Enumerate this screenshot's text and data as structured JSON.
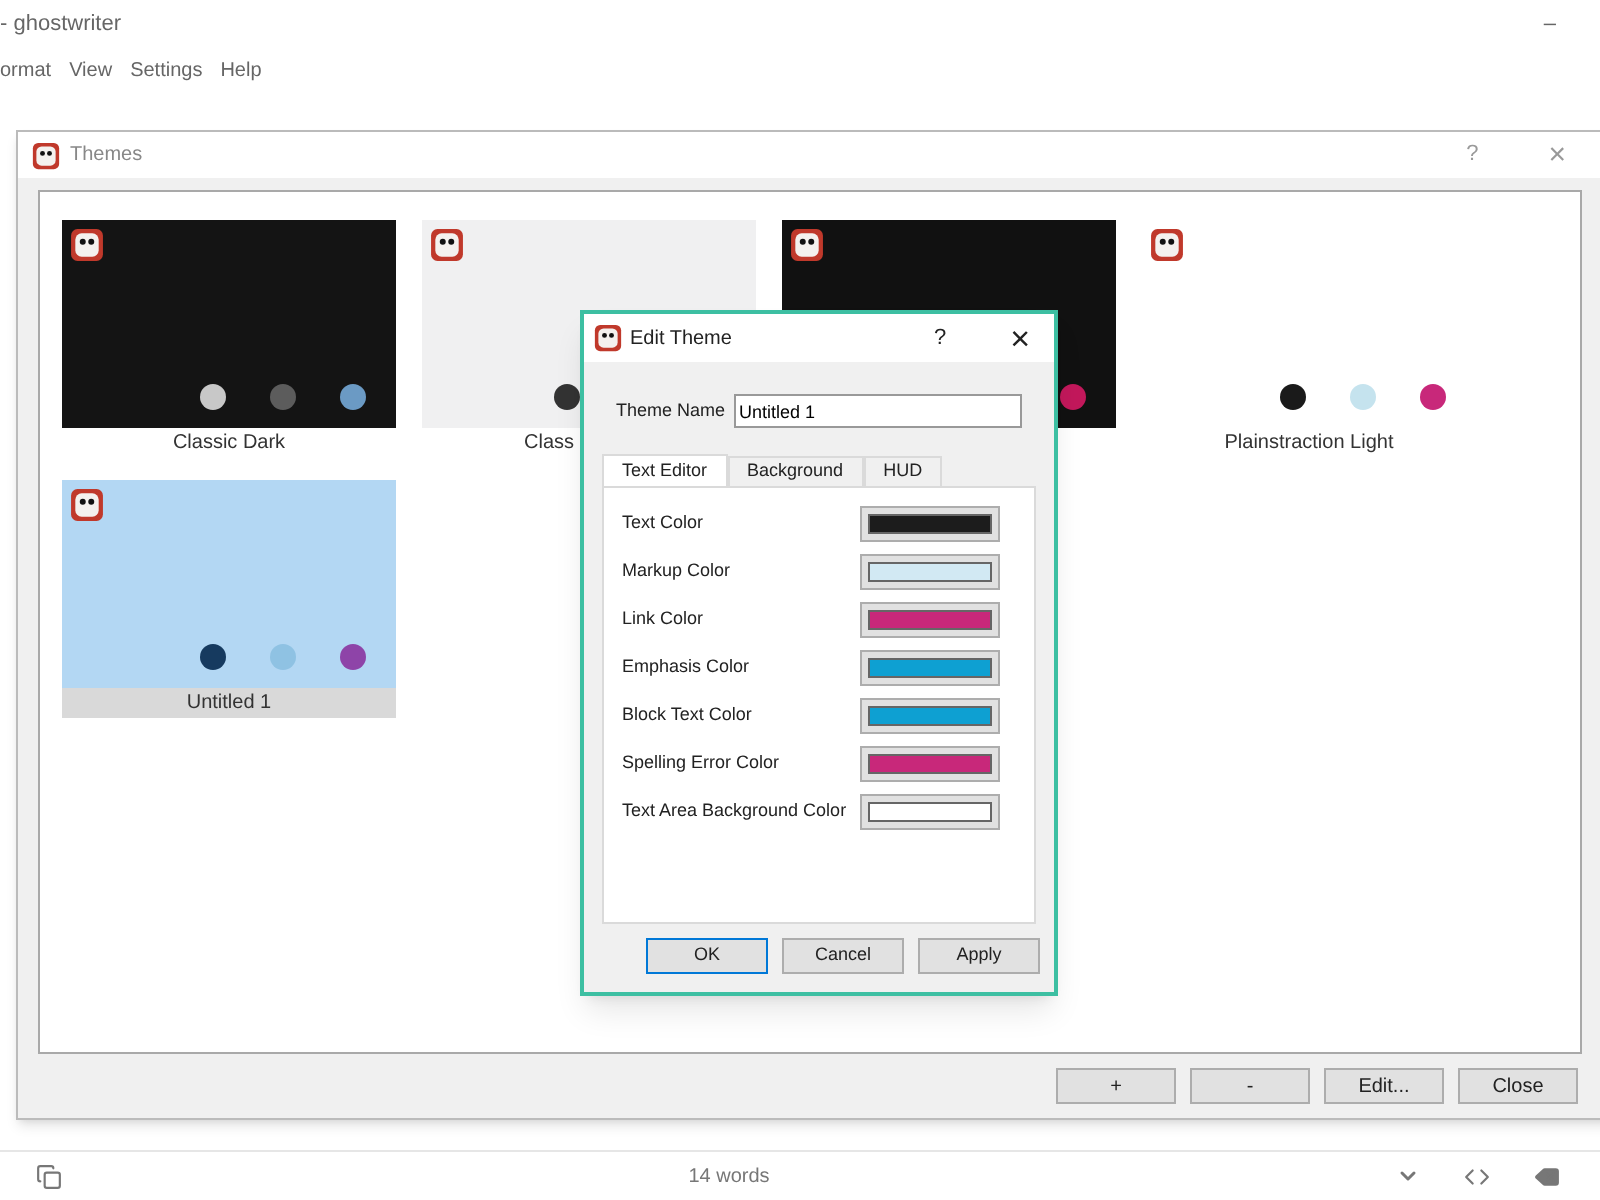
{
  "window": {
    "title": "- ghostwriter",
    "minimize": "–"
  },
  "menu": [
    "ormat",
    "View",
    "Settings",
    "Help"
  ],
  "themes_dialog": {
    "title": "Themes",
    "help": "?",
    "close": "×",
    "cards": [
      {
        "name": "Classic Dark",
        "color": "#141414",
        "selected": false,
        "dots": [
          {
            "color": "#c8c8c8"
          },
          {
            "color": "#5c5c5c"
          },
          {
            "color": "#6b9ac4"
          }
        ]
      },
      {
        "name": "Class",
        "color": "#f0f0f1",
        "selected": false,
        "dots": [
          {
            "color": "#333333"
          }
        ]
      },
      {
        "color": "#111111",
        "selected": false,
        "dots": [
          {
            "color": "#c2185b"
          }
        ]
      },
      {
        "name": "Plainstraction Light",
        "color": "#ffffff",
        "selected": false,
        "dots": [
          {
            "color": "#1a1a1a"
          },
          {
            "color": "#c5e3ee"
          },
          {
            "color": "#c8287a"
          }
        ]
      },
      {
        "name": "Untitled 1",
        "color": "#b3d7f3",
        "selected": true,
        "dots": [
          {
            "color": "#163a5f"
          },
          {
            "color": "#8fc2e3"
          },
          {
            "color": "#8e44a8"
          }
        ]
      }
    ],
    "buttons": [
      "+",
      "-",
      "Edit...",
      "Close"
    ]
  },
  "edit_dialog": {
    "title": "Edit Theme",
    "help": "?",
    "close": "×",
    "name_label": "Theme Name",
    "name_value": "Untitled 1",
    "tabs": [
      {
        "label": "Text Editor",
        "selected": true
      },
      {
        "label": "Background",
        "selected": false
      },
      {
        "label": "HUD",
        "selected": false
      }
    ],
    "colors": [
      {
        "label": "Text Color",
        "color": "#1c1c1c"
      },
      {
        "label": "Markup Color",
        "color": "#d2e9f3"
      },
      {
        "label": "Link Color",
        "color": "#c8287a"
      },
      {
        "label": "Emphasis Color",
        "color": "#0ea0d2"
      },
      {
        "label": "Block Text Color",
        "color": "#0ea0d2"
      },
      {
        "label": "Spelling Error Color",
        "color": "#c8287a"
      },
      {
        "label": "Text Area Background Color",
        "color": "#ffffff"
      }
    ],
    "buttons": [
      {
        "label": "OK",
        "default": true
      },
      {
        "label": "Cancel",
        "default": false
      },
      {
        "label": "Apply",
        "default": false
      }
    ]
  },
  "status_bar": {
    "word_count": "14 words"
  }
}
